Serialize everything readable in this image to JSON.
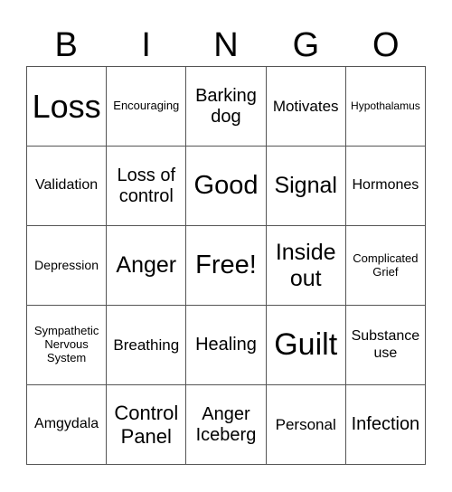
{
  "header": [
    "B",
    "I",
    "N",
    "G",
    "O"
  ],
  "cells": [
    {
      "text": "Loss",
      "size": "s35"
    },
    {
      "text": "Encouraging",
      "size": "s13"
    },
    {
      "text": "Barking dog",
      "size": "s20"
    },
    {
      "text": "Motivates",
      "size": "s17"
    },
    {
      "text": "Hypothalamus",
      "size": "s12"
    },
    {
      "text": "Validation",
      "size": "s16"
    },
    {
      "text": "Loss of control",
      "size": "s20"
    },
    {
      "text": "Good",
      "size": "s29"
    },
    {
      "text": "Signal",
      "size": "s25"
    },
    {
      "text": "Hormones",
      "size": "s16"
    },
    {
      "text": "Depression",
      "size": "s14"
    },
    {
      "text": "Anger",
      "size": "s25"
    },
    {
      "text": "Free!",
      "size": "s29"
    },
    {
      "text": "Inside out",
      "size": "s25"
    },
    {
      "text": "Complicated Grief",
      "size": "s13"
    },
    {
      "text": "Sympathetic Nervous System",
      "size": "s13"
    },
    {
      "text": "Breathing",
      "size": "s17"
    },
    {
      "text": "Healing",
      "size": "s20"
    },
    {
      "text": "Guilt",
      "size": "s34"
    },
    {
      "text": "Substance use",
      "size": "s16"
    },
    {
      "text": "Amgydala",
      "size": "s16"
    },
    {
      "text": "Control Panel",
      "size": "s22"
    },
    {
      "text": "Anger Iceberg",
      "size": "s20"
    },
    {
      "text": "Personal",
      "size": "s17"
    },
    {
      "text": "Infection",
      "size": "s20"
    }
  ]
}
